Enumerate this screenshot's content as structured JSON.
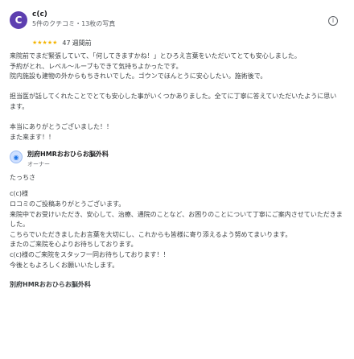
{
  "review": {
    "avatar_letter": "C",
    "reviewer_name": "c(c)",
    "reviewer_stats": "5件のクチコミ・13枚の写真",
    "stars": "★★★★★",
    "rating_count": "47",
    "rating_time": "週間前",
    "text": "来院前でまだ緊張していて、「何してきますかね！」とひろえ言葉をいただいてとても安心しました。\n予約がとれ、レベル〜ルーブもできて気持ちよかったです。\n院内施設も建物の外からもちきれいでした。ゴウンでほんとうに安心したい。施術後で。\n\n担当医が話してくれたことでとても安心した事がいくつかありました。全てに丁寧に答えていただいたように思います。\n\n本当にありがとうございました！！\nまた来ます！！"
  },
  "owner_reply": {
    "name": "別府HMRおおひらお脳外科",
    "role": "オーナー",
    "greeting": "たっちさ",
    "text": "c(c)様\nロコミのご投稿ありがとうございます。\n来院中でお受けいただき、安心して、治療、通院のことなど、お困りのことについて丁寧にご案内させていただきました。\nこちらでいただきましたお言葉を大切にし、これからも皆様に寄り添えるよう努めてまいります。\nまたのご来院を心よりお待ちしております。\nc(c)様のご来院をスタッフ一同お待ちしております！！\n今後ともよろしくお願いいたします。",
    "signature": "別府HMRおおひらお脳外科"
  },
  "icons": {
    "info": "i",
    "owner_avatar": "◉"
  }
}
